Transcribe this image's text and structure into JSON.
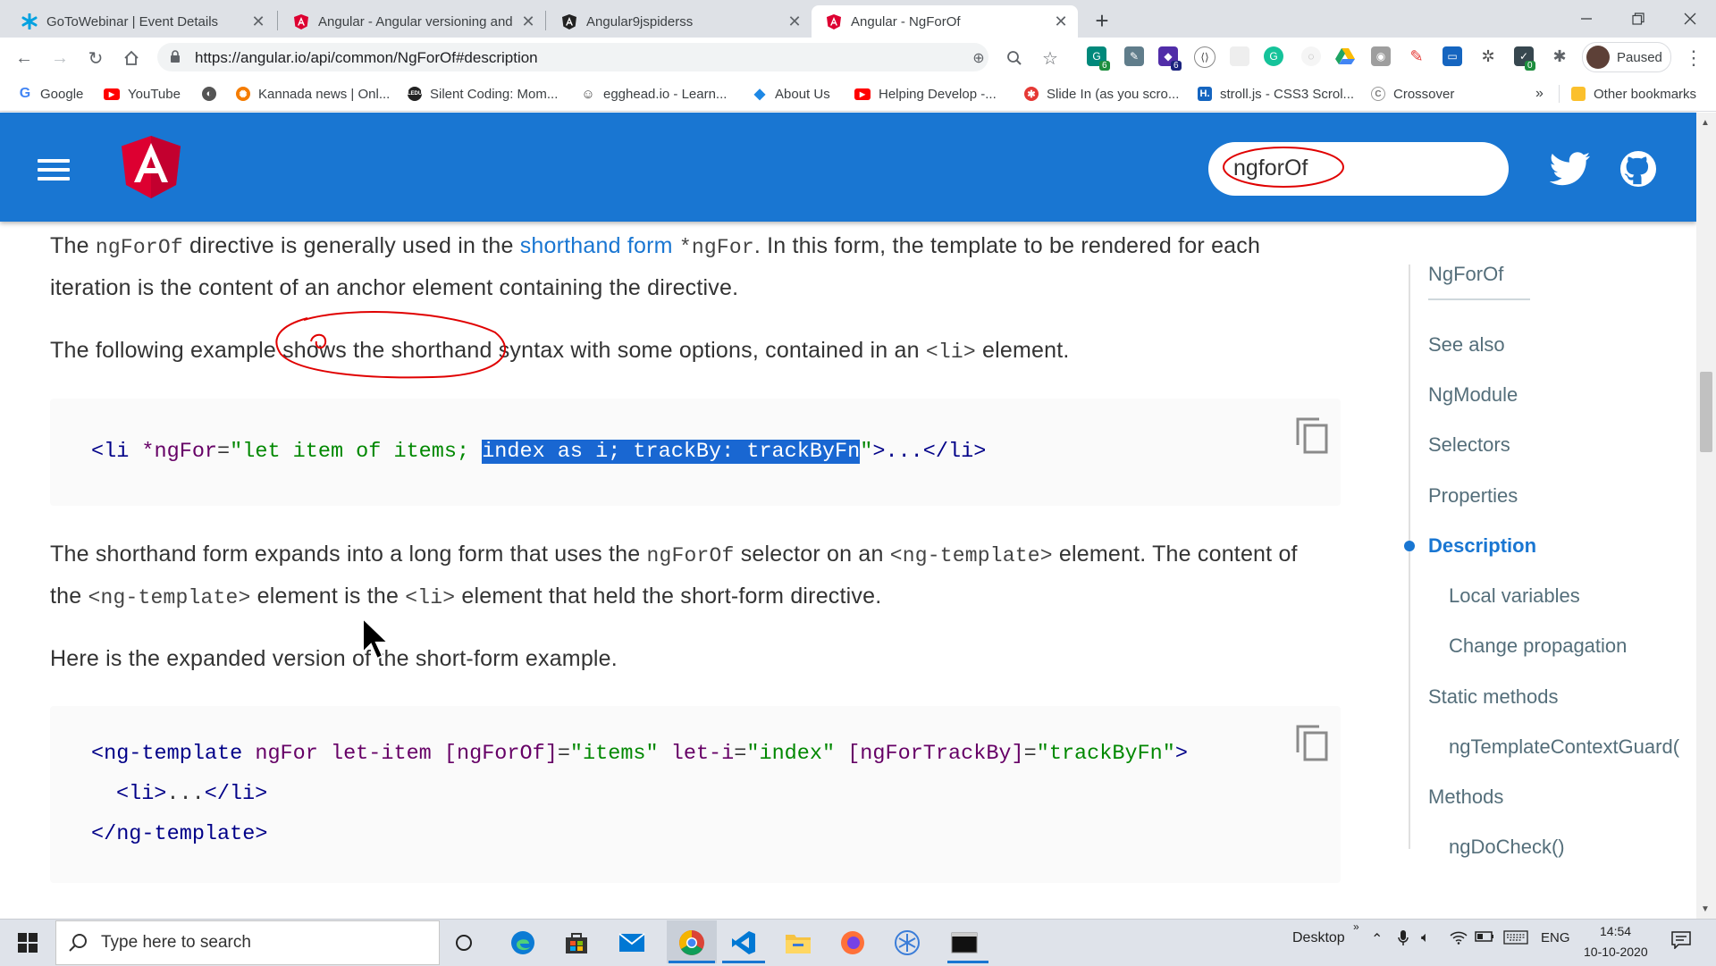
{
  "browser": {
    "tabs": [
      {
        "title": "GoToWebinar | Event Details",
        "icon": "gotowebinar-icon",
        "color": "#00a1e0"
      },
      {
        "title": "Angular - Angular versioning and",
        "icon": "angular-icon",
        "color": "#dd0031"
      },
      {
        "title": "Angular9jspiderss",
        "icon": "angular-mono-icon",
        "color": "#222222"
      },
      {
        "title": "Angular - NgForOf",
        "icon": "angular-icon",
        "color": "#dd0031"
      }
    ],
    "url": "https://angular.io/api/common/NgForOf#description",
    "profile_label": "Paused",
    "extension_badges": [
      "6",
      "6",
      "0"
    ],
    "bookmarks": [
      {
        "label": "Google",
        "icon": "google-icon",
        "color": "#4285f4"
      },
      {
        "label": "YouTube",
        "icon": "youtube-icon",
        "color": "#ff0000"
      },
      {
        "label": "",
        "icon": "globe-icon",
        "color": "#555555"
      },
      {
        "label": "Kannada news | Onl...",
        "icon": "kannada-news-icon",
        "color": "#f57c00"
      },
      {
        "label": "Silent Coding: Mom...",
        "icon": "silent-coding-icon",
        "color": "#222222"
      },
      {
        "label": "egghead.io - Learn...",
        "icon": "egghead-icon",
        "color": "#444444"
      },
      {
        "label": "About Us",
        "icon": "about-us-icon",
        "color": "#1e88e5"
      },
      {
        "label": "Helping Develop -...",
        "icon": "youtube-icon",
        "color": "#ff0000"
      },
      {
        "label": "Slide In (as you scro...",
        "icon": "slide-in-icon",
        "color": "#e53935"
      },
      {
        "label": "stroll.js - CSS3 Scrol...",
        "icon": "stroll-icon",
        "color": "#1565c0"
      },
      {
        "label": "Crossover",
        "icon": "crossover-icon",
        "color": "#777777"
      }
    ],
    "bookmarks_more": "»",
    "other_bookmarks": "Other bookmarks"
  },
  "header": {
    "search_value": "ngforOf",
    "brand_color": "#1976d2"
  },
  "content": {
    "p1": {
      "t1": "The ",
      "c1": "ngForOf",
      "t2": " directive is generally used in the ",
      "link": "shorthand form",
      "t3": " ",
      "c2": "*ngFor",
      "t4": ". In this form, the template to be rendered for each iteration is the content of an anchor element containing the directive."
    },
    "p2": {
      "t1": "The following example shows the shorthand syntax with some options, contained in an ",
      "c1": "<li>",
      "t2": " element."
    },
    "code1": {
      "a": "<li",
      "b": " *ngFor",
      "c": "=",
      "d": "\"let item of items; ",
      "sel": "index as i; trackBy: trackByFn",
      "e": "\"",
      "f": ">...",
      "g": "</li>"
    },
    "p3": {
      "t1": "The shorthand form expands into a long form that uses the ",
      "c1": "ngForOf",
      "t2": " selector on an ",
      "c2": "<ng-template>",
      "t3": " element. The content of the ",
      "c3": "<ng-template>",
      "t4": " element is the ",
      "c4": "<li>",
      "t5": " element that held the short-form directive."
    },
    "p4": "Here is the expanded version of the short-form example.",
    "code2": {
      "l1": {
        "a": "<ng-template",
        "b": " ngFor",
        "c": " let-item",
        "d": " [ngForOf]",
        "e": "=",
        "f": "\"items\"",
        "g": " let-i",
        "h": "=",
        "i": "\"index\"",
        "j": " [ngForTrackBy]",
        "k": "=",
        "l": "\"trackByFn\"",
        "m": ">"
      },
      "l2": {
        "a": "<li>",
        "b": "...",
        "c": "</li>"
      },
      "l3": "</ng-template>"
    }
  },
  "toc": {
    "title": "NgForOf",
    "items": [
      {
        "label": "See also",
        "level": 1
      },
      {
        "label": "NgModule",
        "level": 1
      },
      {
        "label": "Selectors",
        "level": 1
      },
      {
        "label": "Properties",
        "level": 1
      },
      {
        "label": "Description",
        "level": 1,
        "active": true
      },
      {
        "label": "Local variables",
        "level": 2
      },
      {
        "label": "Change propagation",
        "level": 2
      },
      {
        "label": "Static methods",
        "level": 1
      },
      {
        "label": "ngTemplateContextGuard(",
        "level": 2
      },
      {
        "label": "Methods",
        "level": 1
      },
      {
        "label": "ngDoCheck()",
        "level": 2
      }
    ]
  },
  "taskbar": {
    "search_placeholder": "Type here to search",
    "desktop_label": "Desktop",
    "language": "ENG",
    "time": "14:54",
    "date": "10-10-2020"
  }
}
